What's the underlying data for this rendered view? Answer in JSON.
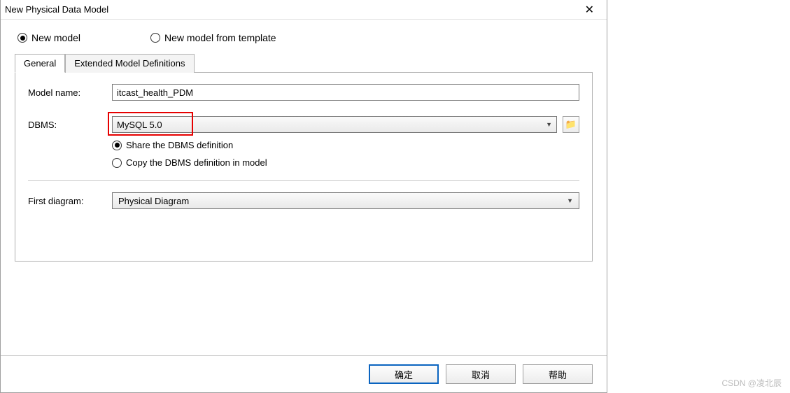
{
  "titlebar": {
    "title": "New Physical Data Model"
  },
  "top_options": {
    "new_model": "New model",
    "new_from_template": "New model from template"
  },
  "tabs": {
    "general": "General",
    "extended": "Extended Model Definitions"
  },
  "fields": {
    "model_name_label": "Model name:",
    "model_name_value": "itcast_health_PDM",
    "dbms_label": "DBMS:",
    "dbms_value": "MySQL 5.0",
    "share_dbms": "Share the DBMS definition",
    "copy_dbms": "Copy the DBMS definition in model",
    "first_diagram_label": "First diagram:",
    "first_diagram_value": "Physical Diagram"
  },
  "buttons": {
    "ok": "确定",
    "cancel": "取消",
    "help": "帮助"
  },
  "watermark": "CSDN @凌北辰"
}
